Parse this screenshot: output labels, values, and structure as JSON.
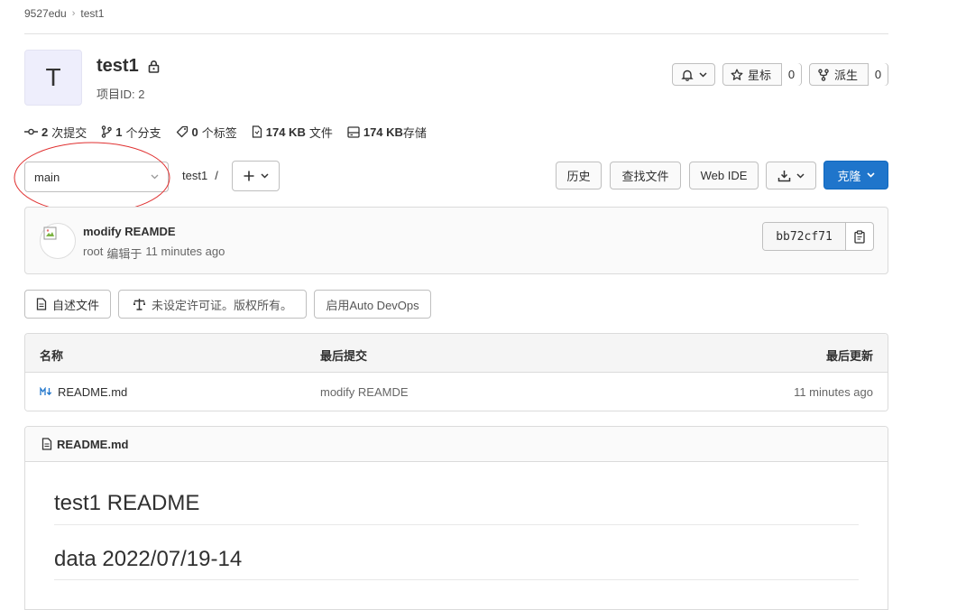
{
  "breadcrumb": {
    "group": "9527edu",
    "project": "test1"
  },
  "project": {
    "avatar_letter": "T",
    "name": "test1",
    "id_label": "项目ID: 2"
  },
  "actions": {
    "star_label": "星标",
    "star_count": "0",
    "fork_label": "派生",
    "fork_count": "0"
  },
  "stats": {
    "commits_count": "2",
    "commits_label": "次提交",
    "branches_count": "1",
    "branches_label": "个分支",
    "tags_count": "0",
    "tags_label": "个标签",
    "files_size": "174 KB",
    "files_label": "文件",
    "storage_size": "174 KB",
    "storage_label": "存储"
  },
  "toolbar": {
    "branch": "main",
    "path": "test1",
    "path_sep": "/",
    "history": "历史",
    "find_file": "查找文件",
    "web_ide": "Web IDE",
    "clone": "克隆"
  },
  "commit": {
    "message": "modify REAMDE",
    "author": "root",
    "action": "编辑于",
    "time": "11 minutes ago",
    "sha": "bb72cf71"
  },
  "badges": {
    "readme": "自述文件",
    "license": "未设定许可证。版权所有。",
    "autodevops": "启用Auto DevOps"
  },
  "table": {
    "headers": {
      "name": "名称",
      "last_commit": "最后提交",
      "last_update": "最后更新"
    },
    "rows": [
      {
        "name": "README.md",
        "commit": "modify REAMDE",
        "updated": "11 minutes ago"
      }
    ]
  },
  "readme": {
    "filename": "README.md",
    "h1": "test1 README",
    "h2": "data 2022/07/19-14"
  },
  "colors": {
    "primary": "#1f75cb",
    "annotation": "#e03030"
  }
}
